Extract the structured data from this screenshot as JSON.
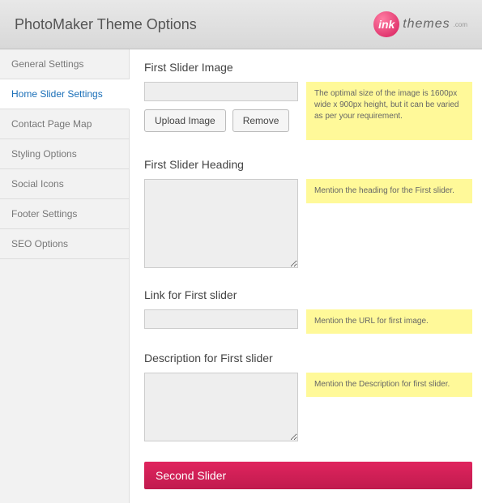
{
  "header": {
    "title": "PhotoMaker Theme Options",
    "logo_badge": "ink",
    "logo_text": "themes",
    "logo_sub": ".com"
  },
  "sidebar": {
    "items": [
      {
        "label": "General Settings",
        "active": false
      },
      {
        "label": "Home Slider Settings",
        "active": true
      },
      {
        "label": "Contact Page Map",
        "active": false
      },
      {
        "label": "Styling Options",
        "active": false
      },
      {
        "label": "Social Icons",
        "active": false
      },
      {
        "label": "Footer Settings",
        "active": false
      },
      {
        "label": "SEO Options",
        "active": false
      }
    ]
  },
  "sections": {
    "image": {
      "title": "First Slider Image",
      "value": "",
      "upload_label": "Upload Image",
      "remove_label": "Remove",
      "hint": "The optimal size of the image is 1600px wide x 900px height, but it can be varied as per your requirement."
    },
    "heading": {
      "title": "First Slider Heading",
      "value": "",
      "hint": "Mention the heading for the First slider."
    },
    "link": {
      "title": "Link for First slider",
      "value": "",
      "hint": "Mention the URL for first image."
    },
    "description": {
      "title": "Description for First slider",
      "value": "",
      "hint": "Mention the Description for first slider."
    }
  },
  "accordion": {
    "second": "Second Slider"
  }
}
